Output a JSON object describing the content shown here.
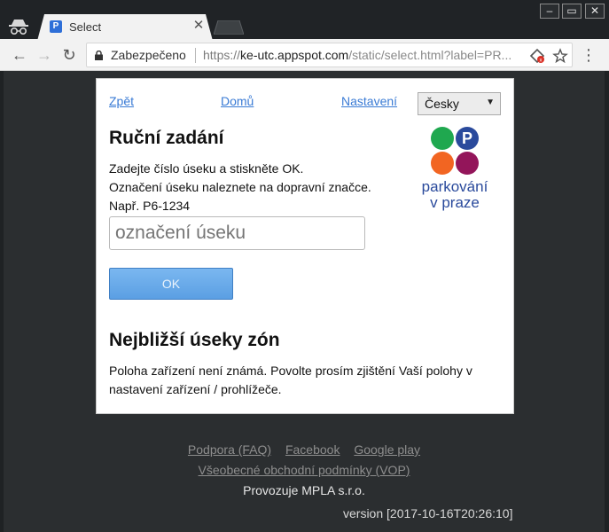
{
  "browser": {
    "tab_title": "Select",
    "tab_favicon_letter": "P",
    "new_tab_icon": "new-tab-icon",
    "window_controls": [
      "minimize-icon",
      "maximize-icon",
      "close-icon"
    ],
    "security_label": "Zabezpečeno",
    "url_scheme": "https://",
    "url_host": "ke-utc.appspot.com",
    "url_path": "/static/select.html?label=PR..."
  },
  "nav": {
    "back": "Zpět",
    "home": "Domů",
    "settings": "Nastavení",
    "language": "Česky"
  },
  "manual": {
    "title": "Ruční zadání",
    "help_line1": "Zadejte číslo úseku a stiskněte OK.",
    "help_line2": "Označení úseku naleznete na dopravní značce.",
    "help_line3": "Např. P6-1234",
    "input_placeholder": "označení úseku",
    "ok_label": "OK"
  },
  "logo": {
    "line1": "parkování",
    "line2": "v praze",
    "colors": [
      "#1fa84f",
      "#2a4a9c",
      "#f26522",
      "#93155a"
    ]
  },
  "nearest": {
    "title": "Nejbližší úseky zón",
    "message": "Poloha zařízení není známá. Povolte prosím zjištění Vaší polohy v nastavení zařízení / prohlížeče."
  },
  "footer": {
    "faq": "Podpora (FAQ)",
    "facebook": "Facebook",
    "google_play": "Google play",
    "terms": "Všeobecné obchodní podmínky (VOP)",
    "operator": "Provozuje MPLA s.r.o.",
    "version": "version [2017-10-16T20:26:10]"
  }
}
